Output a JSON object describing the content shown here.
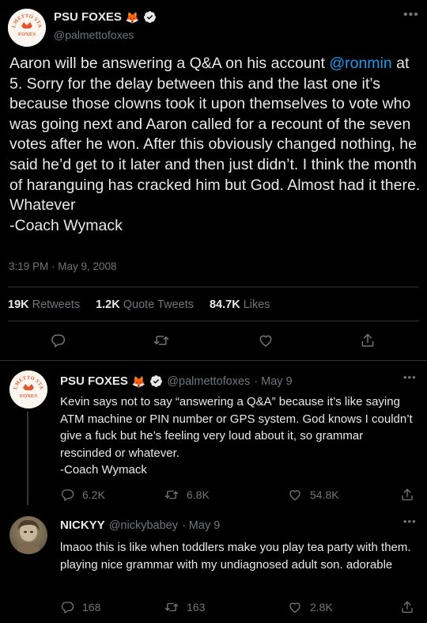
{
  "main_tweet": {
    "author_name": "PSU FOXES",
    "author_emoji": "🦊",
    "handle": "@palmettofoxes",
    "avatar_text_top": "PALMETTO STATE",
    "avatar_text_bottom": "FOXES",
    "text_before_mention": "Aaron will be answering a Q&A on his account ",
    "mention": "@ronmin",
    "text_after_mention": " at 5. Sorry for the delay between this and the last one it’s because those clowns took it upon themselves to vote who was going next and Aaron called for a recount of the seven votes after he won. After this obviously changed nothing, he said he’d get to it later and then just didn’t. I think the month of haranguing has cracked him but God. Almost had it there. Whatever",
    "signature": "-Coach Wymack",
    "timestamp": "3:19 PM · May 9, 2008",
    "retweets_count": "19K",
    "retweets_label": "Retweets",
    "quotes_count": "1.2K",
    "quotes_label": "Quote Tweets",
    "likes_count": "84.7K",
    "likes_label": "Likes"
  },
  "replies": [
    {
      "author_name": "PSU FOXES",
      "author_emoji": "🦊",
      "handle": "@palmettofoxes",
      "date": "· May 9",
      "avatar_text_top": "PALMETTO STATE",
      "avatar_text_bottom": "FOXES",
      "text": "Kevin says not to say “answering a Q&A” because it’s like saying ATM machine or PIN number or GPS system. God knows I couldn’t give a fuck but he’s feeling very loud about it, so grammar rescinded or whatever.",
      "signature": "-Coach Wymack",
      "replies": "6.2K",
      "retweets": "6.8K",
      "likes": "54.8K"
    },
    {
      "author_name": "NICKYY",
      "handle": "@nickybabey",
      "date": "· May 9",
      "text": "lmaoo this is like when toddlers make you play tea party with them. playing nice grammar with my undiagnosed adult son. adorable",
      "replies": "168",
      "retweets": "163",
      "likes": "2.8K"
    }
  ],
  "icons": {
    "verified": "verified-badge-icon",
    "reply": "reply-icon",
    "retweet": "retweet-icon",
    "like": "heart-icon",
    "share": "share-icon",
    "more": "more-icon"
  },
  "colors": {
    "background": "#000000",
    "text": "#e7e9ea",
    "muted": "#71767b",
    "link": "#1d9bf0",
    "divider": "#2f3336",
    "logo_orange": "#e4572e"
  }
}
